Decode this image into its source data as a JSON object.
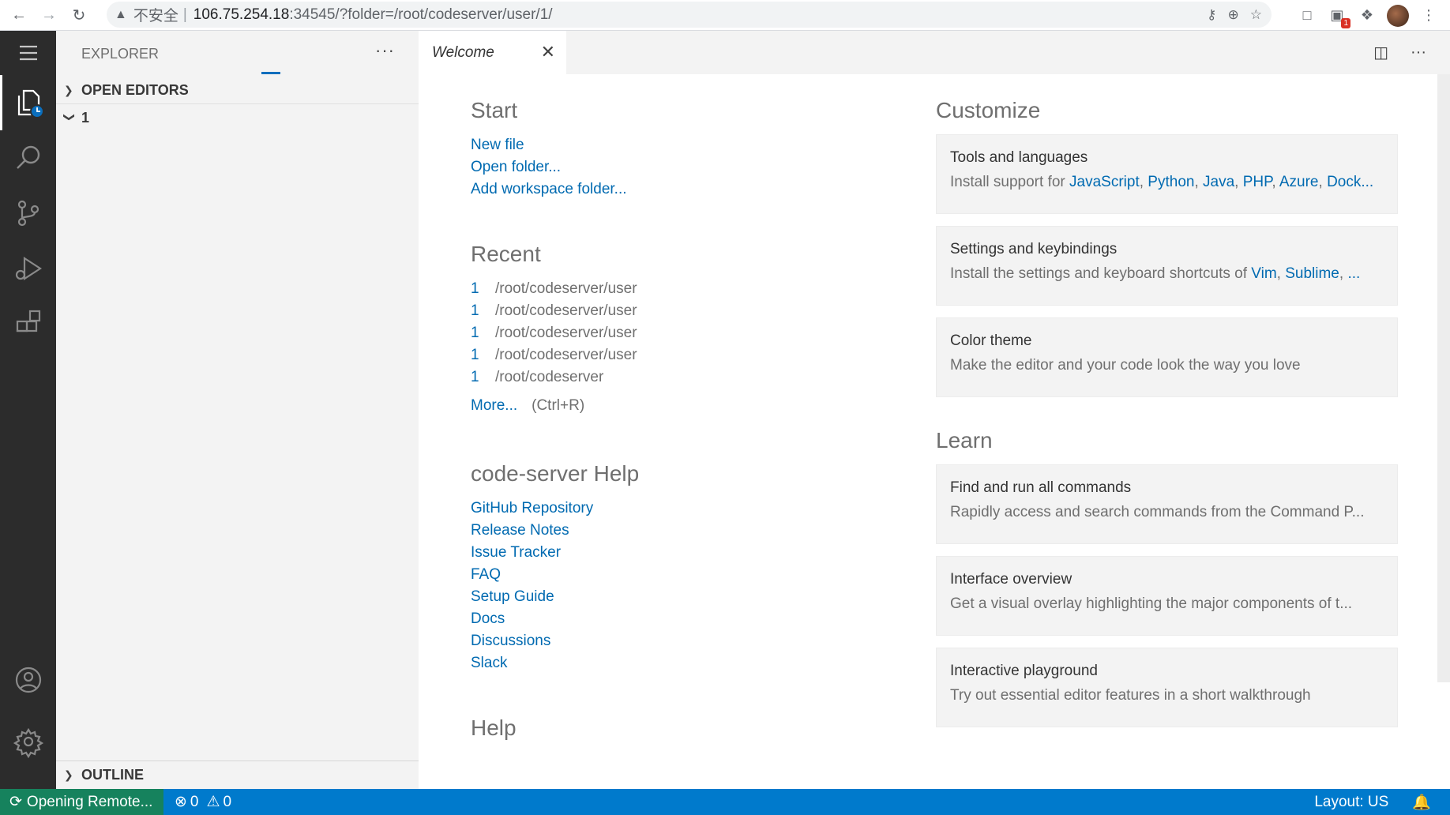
{
  "browser": {
    "insecure_label": "不安全",
    "url_host": "106.75.254.18",
    "url_rest": ":34545/?folder=/root/codeserver/user/1/",
    "extension_badge": "1"
  },
  "sidebar": {
    "title": "EXPLORER",
    "open_editors": "OPEN EDITORS",
    "folder": "1",
    "outline": "OUTLINE"
  },
  "editor": {
    "tab_label": "Welcome"
  },
  "welcome": {
    "start": {
      "title": "Start",
      "links": [
        "New file",
        "Open folder...",
        "Add workspace folder..."
      ]
    },
    "recent": {
      "title": "Recent",
      "items": [
        {
          "name": "1",
          "path": "/root/codeserver/user"
        },
        {
          "name": "1",
          "path": "/root/codeserver/user"
        },
        {
          "name": "1",
          "path": "/root/codeserver/user"
        },
        {
          "name": "1",
          "path": "/root/codeserver/user"
        },
        {
          "name": "1",
          "path": "/root/codeserver"
        }
      ],
      "more": "More...",
      "more_shortcut": "(Ctrl+R)"
    },
    "help": {
      "title": "code-server Help",
      "links": [
        "GitHub Repository",
        "Release Notes",
        "Issue Tracker",
        "FAQ",
        "Setup Guide",
        "Docs",
        "Discussions",
        "Slack"
      ]
    },
    "help2_title": "Help",
    "customize": {
      "title": "Customize",
      "cards": [
        {
          "title": "Tools and languages",
          "prefix": "Install support for ",
          "links": [
            "JavaScript",
            "Python",
            "Java",
            "PHP",
            "Azure",
            "Dock..."
          ]
        },
        {
          "title": "Settings and keybindings",
          "prefix": "Install the settings and keyboard shortcuts of ",
          "links": [
            "Vim",
            "Sublime",
            "..."
          ]
        },
        {
          "title": "Color theme",
          "desc": "Make the editor and your code look the way you love"
        }
      ]
    },
    "learn": {
      "title": "Learn",
      "cards": [
        {
          "title": "Find and run all commands",
          "desc": "Rapidly access and search commands from the Command P..."
        },
        {
          "title": "Interface overview",
          "desc": "Get a visual overlay highlighting the major components of t..."
        },
        {
          "title": "Interactive playground",
          "desc": "Try out essential editor features in a short walkthrough"
        }
      ]
    }
  },
  "status": {
    "remote": "Opening Remote...",
    "errors": "0",
    "warnings": "0",
    "layout": "Layout: US"
  },
  "colors": {
    "activity_bar": "#2c2c2c",
    "status_bar": "#007acc",
    "remote": "#16825d",
    "link": "#006ab1"
  }
}
